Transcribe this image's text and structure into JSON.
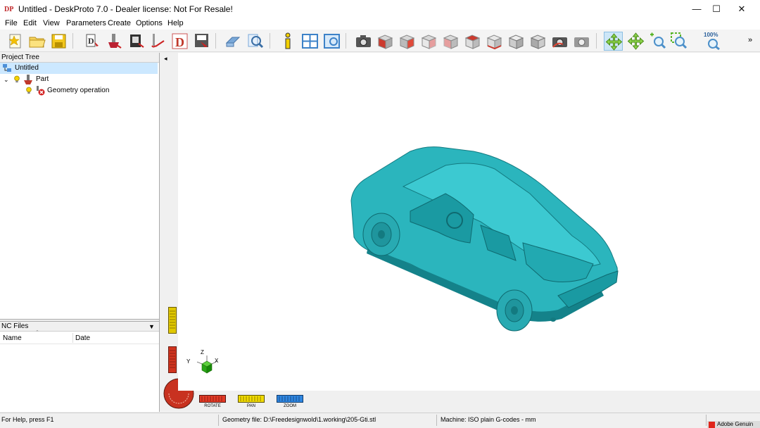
{
  "window": {
    "title": "Untitled - DeskProto 7.0 - Dealer license: Not For Resale!",
    "minimize_glyph": "—",
    "maximize_glyph": "☐",
    "close_glyph": "✕"
  },
  "menu": {
    "items": [
      "File",
      "Edit",
      "View",
      "Parameters",
      "Create",
      "Options",
      "Help"
    ]
  },
  "toolbar": {
    "zoom_label": "100%",
    "overflow_glyph": "»",
    "icons": [
      "new-icon",
      "open-folder-icon",
      "save-icon",
      "part-parameters-icon",
      "operation-parameters-icon",
      "machine-icon",
      "toolpath-icon",
      "nc-d-icon",
      "write-nc-icon",
      "eraser-icon",
      "search-icon",
      "info-icon",
      "four-view-icon",
      "single-view-icon",
      "camera-icon",
      "view-cube-front-icon",
      "view-cube-right-icon",
      "view-cube-back-icon",
      "view-cube-left-icon",
      "view-cube-top-icon",
      "view-cube-bottom-icon",
      "view-cube-iso-icon",
      "view-cube-iso2-icon",
      "camera-reset-icon",
      "camera-gray-icon",
      "rotate-icon",
      "pan-icon",
      "zoom-in-icon",
      "zoom-window-icon",
      "zoom-100-icon"
    ]
  },
  "project_tree": {
    "header": "Project Tree",
    "root": "Untitled",
    "part": "Part",
    "operation": "Geometry operation"
  },
  "nc_files": {
    "header": "NC Files",
    "columns": [
      "Name",
      "Date"
    ]
  },
  "viewport": {
    "collapse_glyph": "◂",
    "axes": {
      "x": "X",
      "y": "Y",
      "z": "Z"
    },
    "meters": {
      "rotate": "ROTATE",
      "pan": "PAN",
      "zoom": "ZOOM"
    },
    "model_color": "#2bb5bd"
  },
  "status": {
    "help": "For Help, press F1",
    "geometry": "Geometry file: D:\\Freedesignwold\\1.working\\205-Gti.stl",
    "machine": "Machine: ISO plain G-codes - mm",
    "taskbar_hint": "Adobe Genuin"
  }
}
